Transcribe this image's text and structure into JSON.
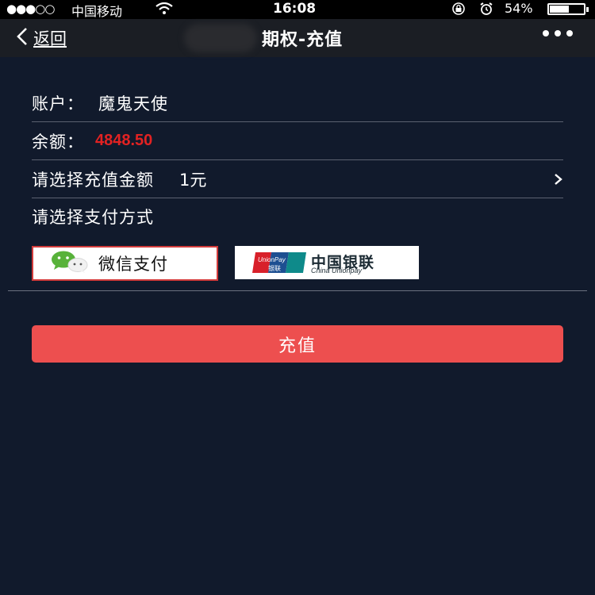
{
  "status_bar": {
    "carrier": "中国移动",
    "time": "16:08",
    "battery_percent": "54%",
    "battery_level": 0.54,
    "signal_text": "●●●○○"
  },
  "nav": {
    "back_label": "返回",
    "title": "期权-充值"
  },
  "form": {
    "account_label": "账户：",
    "account_name": "魔鬼天使",
    "balance_label": "余额：",
    "balance_value": "4848.50",
    "amount_label": "请选择充值金额",
    "amount_value": "1元",
    "payment_label": "请选择支付方式"
  },
  "payment_methods": {
    "wechat_label": "微信支付",
    "unionpay_cn": "中国银联",
    "unionpay_en": "China Unionpay",
    "unionpay_logo_text": "UnionPay",
    "unionpay_logo_cn": "银联"
  },
  "actions": {
    "recharge_label": "充值"
  },
  "colors": {
    "background": "#111a2c",
    "accent_button": "#ed4f4f",
    "balance_red": "#e22222"
  }
}
